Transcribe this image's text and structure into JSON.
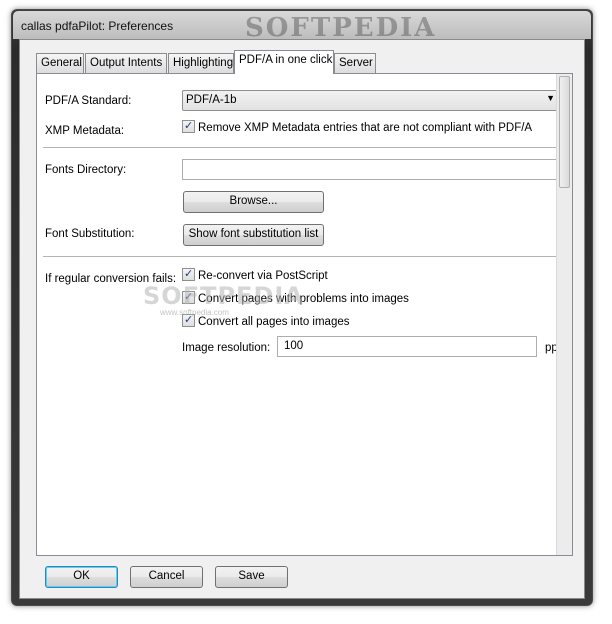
{
  "window": {
    "title": "callas pdfaPilot: Preferences",
    "watermark": "SOFTPEDIA"
  },
  "tabs": [
    {
      "label": "General"
    },
    {
      "label": "Output Intents"
    },
    {
      "label": "Highlighting"
    },
    {
      "label": "PDF/A in one click",
      "active": true
    },
    {
      "label": "Server"
    }
  ],
  "form": {
    "pdfa_standard_label": "PDF/A Standard:",
    "pdfa_standard_value": "PDF/A-1b",
    "xmp_label": "XMP Metadata:",
    "xmp_checkbox_label": "Remove XMP Metadata entries that are not compliant with PDF/A",
    "fonts_dir_label": "Fonts Directory:",
    "fonts_dir_value": "",
    "browse_label": "Browse...",
    "font_subst_label": "Font Substitution:",
    "show_font_subst_label": "Show font substitution list",
    "fallback_label": "If regular conversion fails:",
    "reconvert_label": "Re-convert via PostScript",
    "convert_problem_pages_label": "Convert pages with problems into images",
    "convert_all_pages_label": "Convert all pages into images",
    "image_resolution_label": "Image resolution:",
    "image_resolution_value": "100",
    "image_resolution_unit": "ppi"
  },
  "footer": {
    "ok_label": "OK",
    "cancel_label": "Cancel",
    "save_label": "Save"
  },
  "ghost_watermark": "SOFTPEDIA",
  "ghost_url": "www.softpedia.com"
}
